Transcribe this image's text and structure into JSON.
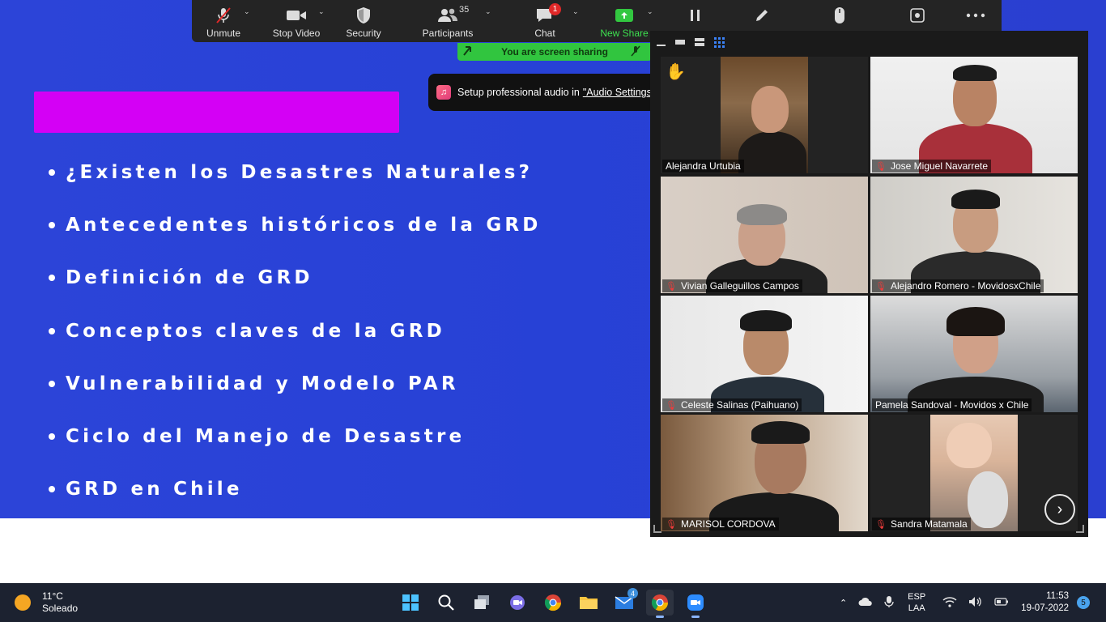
{
  "slide": {
    "bullets": [
      "¿Existen los Desastres Naturales?",
      "Antecedentes históricos de la GRD",
      "Definición de GRD",
      "Conceptos claves de la GRD",
      "Vulnerabilidad y Modelo PAR",
      "Ciclo del Manejo de Desastre",
      "GRD en Chile"
    ],
    "accent_color": "#d400f5",
    "background_color": "#2741d6"
  },
  "toolbar": {
    "unmute": "Unmute",
    "stop_video": "Stop Video",
    "security": "Security",
    "participants": "Participants",
    "participants_count": "35",
    "chat": "Chat",
    "chat_badge": "1",
    "new_share": "New Share"
  },
  "sharing_banner": "You are screen sharing",
  "audio_tip": {
    "text": "Setup professional audio in",
    "link": "\"Audio Settings\""
  },
  "gallery": {
    "participants": [
      {
        "name": "Alejandra Urtubia",
        "muted": false,
        "active": true,
        "hand_raised": true
      },
      {
        "name": "Jose Miguel Navarrete",
        "muted": true
      },
      {
        "name": "Vivian Galleguillos Campos",
        "muted": true
      },
      {
        "name": "Alejandro Romero - MovidosxChile",
        "muted": true
      },
      {
        "name": "Celeste Salinas (Paihuano)",
        "muted": true
      },
      {
        "name": "Pamela Sandoval - Movidos x Chile",
        "muted": false
      },
      {
        "name": "MARISOL CORDOVA",
        "muted": true
      },
      {
        "name": "Sandra Matamala",
        "muted": true
      }
    ]
  },
  "taskbar": {
    "weather_temp": "11°C",
    "weather_desc": "Soleado",
    "mail_badge": "4",
    "lang_1": "ESP",
    "lang_2": "LAA",
    "time": "11:53",
    "date": "19-07-2022",
    "notifications": "5"
  }
}
